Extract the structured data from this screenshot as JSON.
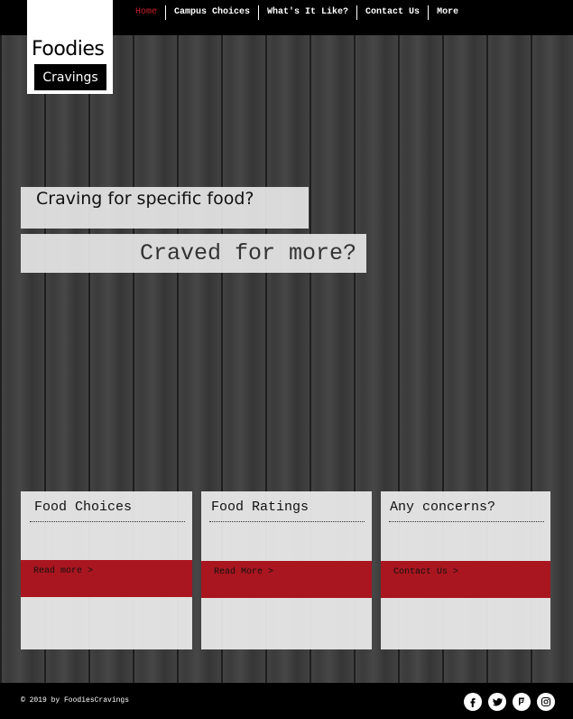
{
  "nav": {
    "items": [
      {
        "label": "Home",
        "active": true
      },
      {
        "label": "Campus Choices",
        "active": false
      },
      {
        "label": "What's It Like?",
        "active": false
      },
      {
        "label": "Contact Us",
        "active": false
      },
      {
        "label": "More",
        "active": false
      }
    ]
  },
  "logo": {
    "title": "Foodies",
    "subtitle": "Cravings"
  },
  "hero": {
    "line1": "Craving for specific food?",
    "line2": "Craved for more?"
  },
  "cards": [
    {
      "title": "Food Choices",
      "link": "Read more >"
    },
    {
      "title": "Food Ratings",
      "link": "Read More >"
    },
    {
      "title": "Any concerns?",
      "link": "Contact Us >"
    }
  ],
  "footer": {
    "copyright": "© 2019 by FoodiesCravings",
    "socials": [
      "facebook-icon",
      "twitter-icon",
      "foursquare-icon",
      "instagram-icon"
    ]
  },
  "colors": {
    "accent_red": "#a9161f",
    "active_nav": "#c8202a",
    "bar_black": "#000000"
  }
}
